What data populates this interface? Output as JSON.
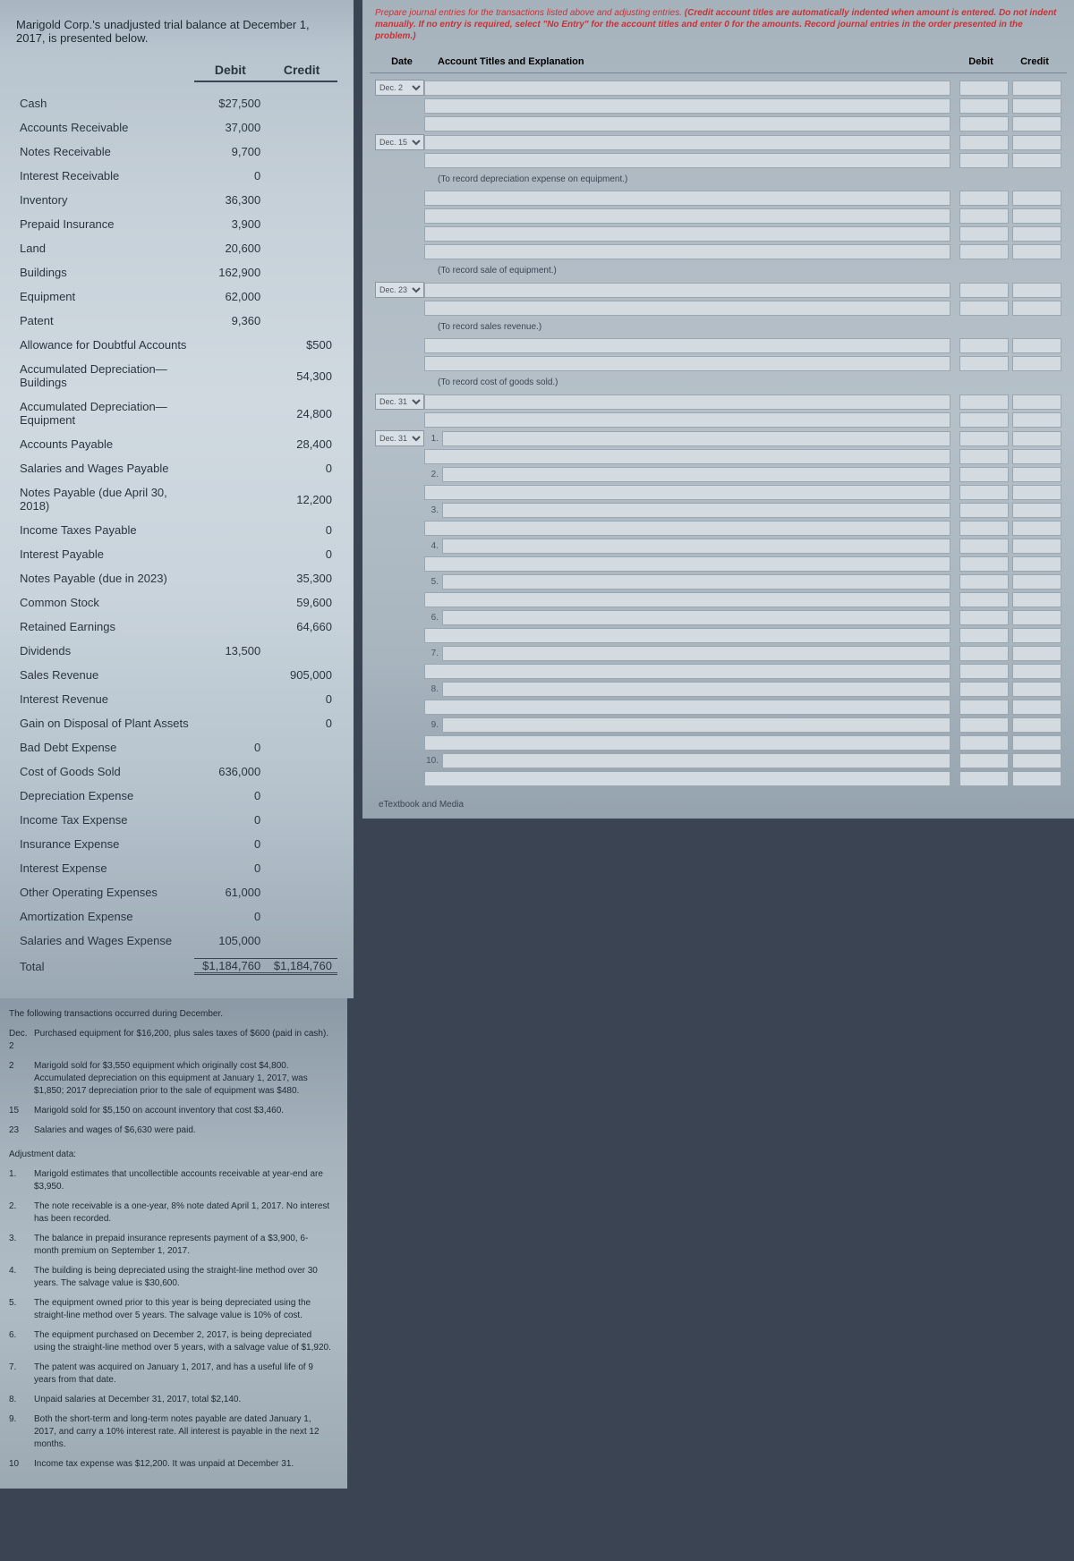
{
  "intro": "Marigold Corp.'s unadjusted trial balance at December 1, 2017, is presented below.",
  "headers": {
    "debit": "Debit",
    "credit": "Credit"
  },
  "tb": [
    {
      "a": "Cash",
      "d": "$27,500",
      "c": ""
    },
    {
      "a": "Accounts Receivable",
      "d": "37,000",
      "c": ""
    },
    {
      "a": "Notes Receivable",
      "d": "9,700",
      "c": ""
    },
    {
      "a": "Interest Receivable",
      "d": "0",
      "c": ""
    },
    {
      "a": "Inventory",
      "d": "36,300",
      "c": ""
    },
    {
      "a": "Prepaid Insurance",
      "d": "3,900",
      "c": ""
    },
    {
      "a": "Land",
      "d": "20,600",
      "c": ""
    },
    {
      "a": "Buildings",
      "d": "162,900",
      "c": ""
    },
    {
      "a": "Equipment",
      "d": "62,000",
      "c": ""
    },
    {
      "a": "Patent",
      "d": "9,360",
      "c": ""
    },
    {
      "a": "Allowance for Doubtful Accounts",
      "d": "",
      "c": "$500"
    },
    {
      "a": "Accumulated Depreciation—Buildings",
      "d": "",
      "c": "54,300"
    },
    {
      "a": "Accumulated Depreciation—Equipment",
      "d": "",
      "c": "24,800"
    },
    {
      "a": "Accounts Payable",
      "d": "",
      "c": "28,400"
    },
    {
      "a": "Salaries and Wages Payable",
      "d": "",
      "c": "0"
    },
    {
      "a": "Notes Payable (due April 30, 2018)",
      "d": "",
      "c": "12,200"
    },
    {
      "a": "Income Taxes Payable",
      "d": "",
      "c": "0"
    },
    {
      "a": "Interest Payable",
      "d": "",
      "c": "0"
    },
    {
      "a": "Notes Payable (due in 2023)",
      "d": "",
      "c": "35,300"
    },
    {
      "a": "Common Stock",
      "d": "",
      "c": "59,600"
    },
    {
      "a": "Retained Earnings",
      "d": "",
      "c": "64,660"
    },
    {
      "a": "Dividends",
      "d": "13,500",
      "c": ""
    },
    {
      "a": "Sales Revenue",
      "d": "",
      "c": "905,000"
    },
    {
      "a": "Interest Revenue",
      "d": "",
      "c": "0"
    },
    {
      "a": "Gain on Disposal of Plant Assets",
      "d": "",
      "c": "0"
    },
    {
      "a": "Bad Debt Expense",
      "d": "0",
      "c": ""
    },
    {
      "a": "Cost of Goods Sold",
      "d": "636,000",
      "c": ""
    },
    {
      "a": "Depreciation Expense",
      "d": "0",
      "c": ""
    },
    {
      "a": "Income Tax Expense",
      "d": "0",
      "c": ""
    },
    {
      "a": "Insurance Expense",
      "d": "0",
      "c": ""
    },
    {
      "a": "Interest Expense",
      "d": "0",
      "c": ""
    },
    {
      "a": "Other Operating Expenses",
      "d": "61,000",
      "c": ""
    },
    {
      "a": "Amortization Expense",
      "d": "0",
      "c": ""
    },
    {
      "a": "Salaries and Wages Expense",
      "d": "105,000",
      "c": ""
    }
  ],
  "total": {
    "label": "Total",
    "d": "$1,184,760",
    "c": "$1,184,760"
  },
  "trans_header": "The following transactions occurred during December.",
  "trans": [
    {
      "l": "Dec. 2",
      "t": "Purchased equipment for $16,200, plus sales taxes of $600 (paid in cash)."
    },
    {
      "l": "2",
      "t": "Marigold sold for $3,550 equipment which originally cost $4,800. Accumulated depreciation on this equipment at January 1, 2017, was $1,850; 2017 depreciation prior to the sale of equipment was $480."
    },
    {
      "l": "15",
      "t": "Marigold sold for $5,150 on account inventory that cost $3,460."
    },
    {
      "l": "23",
      "t": "Salaries and wages of $6,630 were paid."
    }
  ],
  "adj_header": "Adjustment data:",
  "adj": [
    {
      "l": "1.",
      "t": "Marigold estimates that uncollectible accounts receivable at year-end are $3,950."
    },
    {
      "l": "2.",
      "t": "The note receivable is a one-year, 8% note dated April 1, 2017. No interest has been recorded."
    },
    {
      "l": "3.",
      "t": "The balance in prepaid insurance represents payment of a $3,900, 6-month premium on September 1, 2017."
    },
    {
      "l": "4.",
      "t": "The building is being depreciated using the straight-line method over 30 years. The salvage value is $30,600."
    },
    {
      "l": "5.",
      "t": "The equipment owned prior to this year is being depreciated using the straight-line method over 5 years. The salvage value is 10% of cost."
    },
    {
      "l": "6.",
      "t": "The equipment purchased on December 2, 2017, is being depreciated using the straight-line method over 5 years, with a salvage value of $1,920."
    },
    {
      "l": "7.",
      "t": "The patent was acquired on January 1, 2017, and has a useful life of 9 years from that date."
    },
    {
      "l": "8.",
      "t": "Unpaid salaries at December 31, 2017, total $2,140."
    },
    {
      "l": "9.",
      "t": "Both the short-term and long-term notes payable are dated January 1, 2017, and carry a 10% interest rate. All interest is payable in the next 12 months."
    },
    {
      "l": "10",
      "t": "Income tax expense was $12,200. It was unpaid at December 31."
    }
  ],
  "je": {
    "instr_plain": "Prepare journal entries for the transactions listed above and adjusting entries. ",
    "instr_bold": "(Credit account titles are automatically indented when amount is entered. Do not indent manually. If no entry is required, select \"No Entry\" for the account titles and enter 0 for the amounts. Record journal entries in the order presented in the problem.)",
    "th": {
      "date": "Date",
      "acct": "Account Titles and Explanation",
      "debit": "Debit",
      "credit": "Credit"
    },
    "dates": [
      "Dec. 2",
      "Dec. 15",
      "Dec. 23",
      "Dec. 31",
      "Dec. 31"
    ],
    "captions": {
      "dep": "(To record depreciation expense on equipment.)",
      "sale": "(To record sale of equipment.)",
      "rev": "(To record sales revenue.)",
      "cogs": "(To record cost of goods sold.)"
    },
    "adj_nums": [
      "1.",
      "2.",
      "3.",
      "4.",
      "5.",
      "6.",
      "7.",
      "8.",
      "9.",
      "10."
    ],
    "etext": "eTextbook and Media"
  }
}
